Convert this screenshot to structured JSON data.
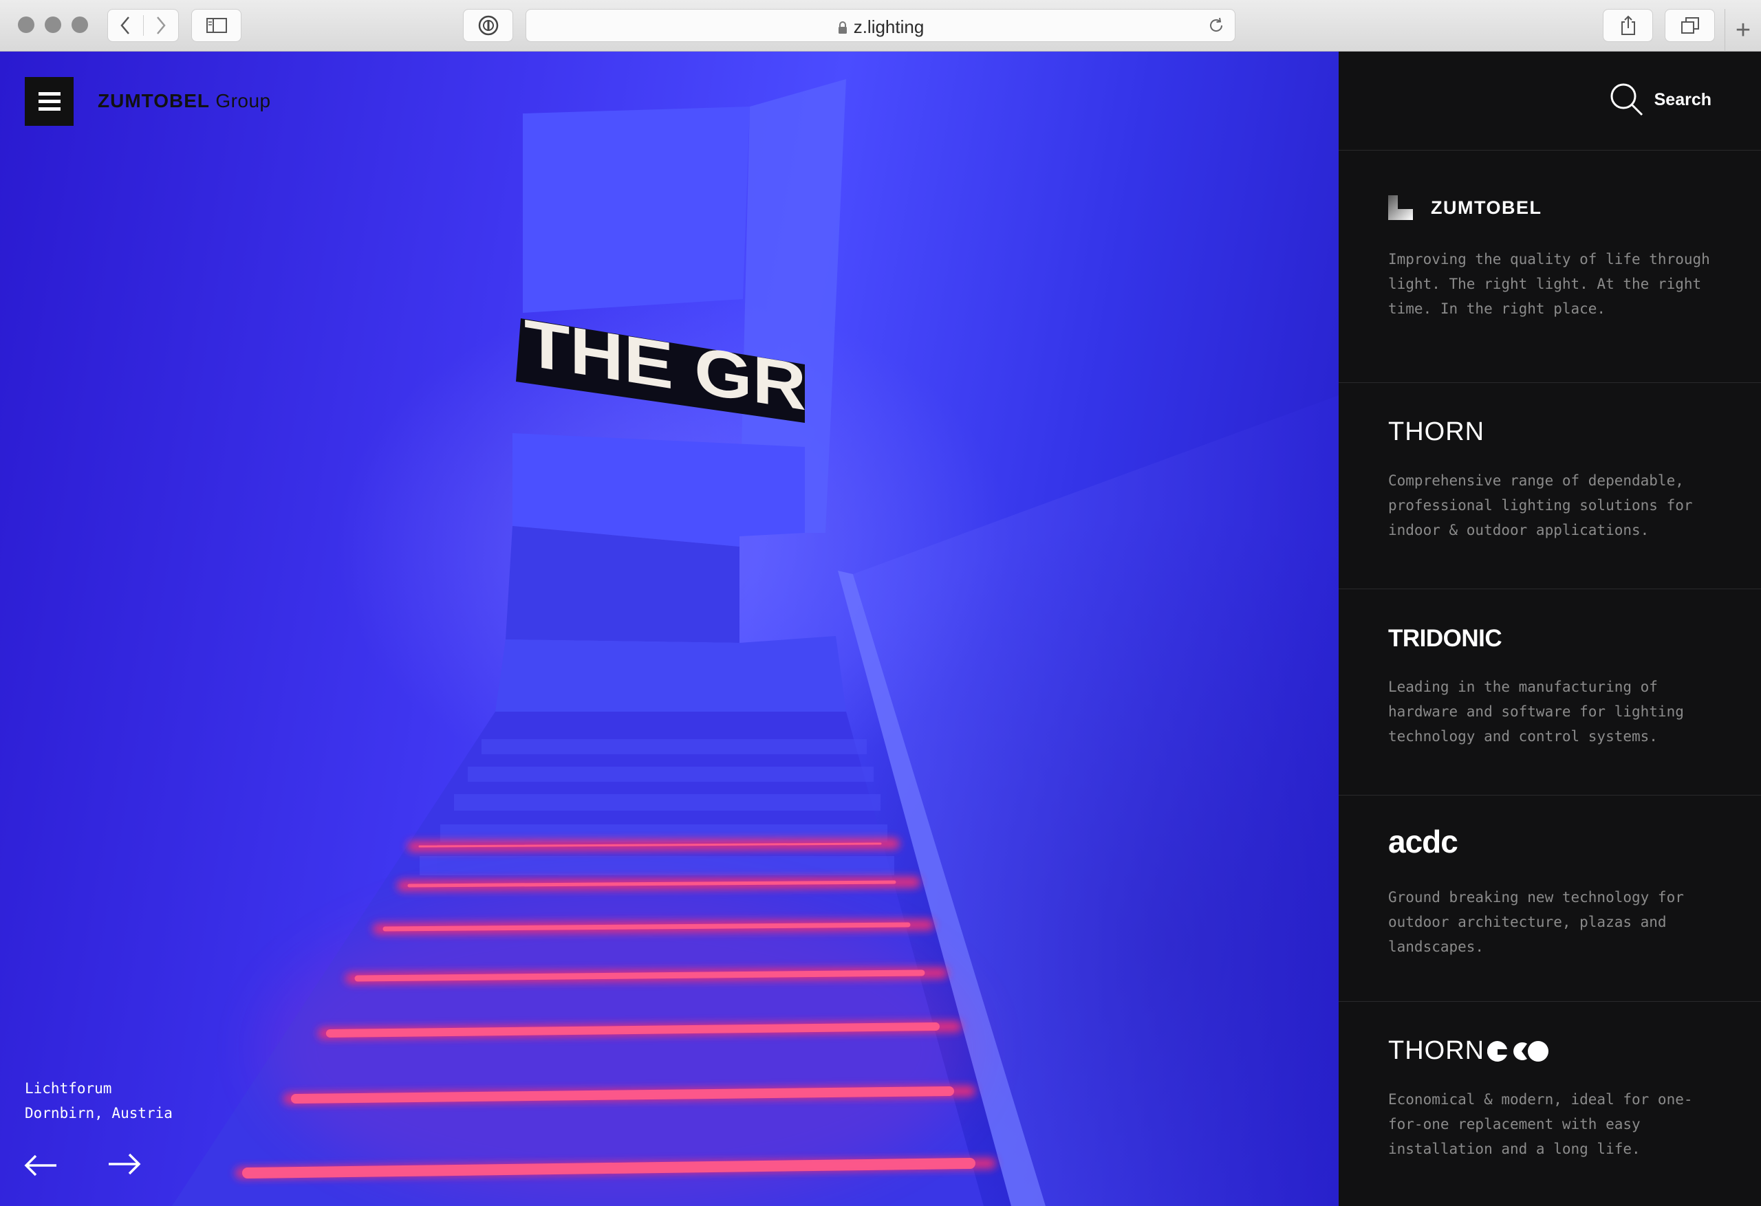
{
  "browser": {
    "url": "z.lighting",
    "icons": [
      "back-arrow-icon",
      "forward-arrow-icon",
      "sidebar-toggle-icon",
      "password-manager-icon",
      "lock-icon",
      "reload-icon",
      "share-icon",
      "tabs-icon",
      "new-tab-icon"
    ]
  },
  "header": {
    "brand_bold": "ZUMTOBEL",
    "brand_light": "Group",
    "menu_icon": "hamburger-icon",
    "sign_text": "THE GR"
  },
  "hero": {
    "location_line1": "Lichtforum",
    "location_line2": "Dornbirn, Austria",
    "prev_icon": "arrow-left-icon",
    "next_icon": "arrow-right-icon"
  },
  "sidebar": {
    "search_label": "Search",
    "brands": [
      {
        "name": "ZUMTOBEL",
        "desc": "Improving the quality of life through light. The right light. At the right time. In the right place."
      },
      {
        "name": "THORN",
        "desc": "Comprehensive range of dependable, professional lighting solutions for indoor & outdoor applications."
      },
      {
        "name": "TRIDONIC",
        "desc": "Leading in the manufacturing of hardware and software for lighting technology and control systems."
      },
      {
        "name": "acdc",
        "desc": "Ground breaking new technology for outdoor architecture, plazas and landscapes."
      },
      {
        "name": "THORN",
        "desc": "Economical & modern, ideal for one-for-one replacement with easy installation and a long life."
      }
    ]
  },
  "colors": {
    "sidebar_bg": "#111112",
    "hero_blue": "#3f36f0",
    "step_glow": "#ff2e6e"
  }
}
